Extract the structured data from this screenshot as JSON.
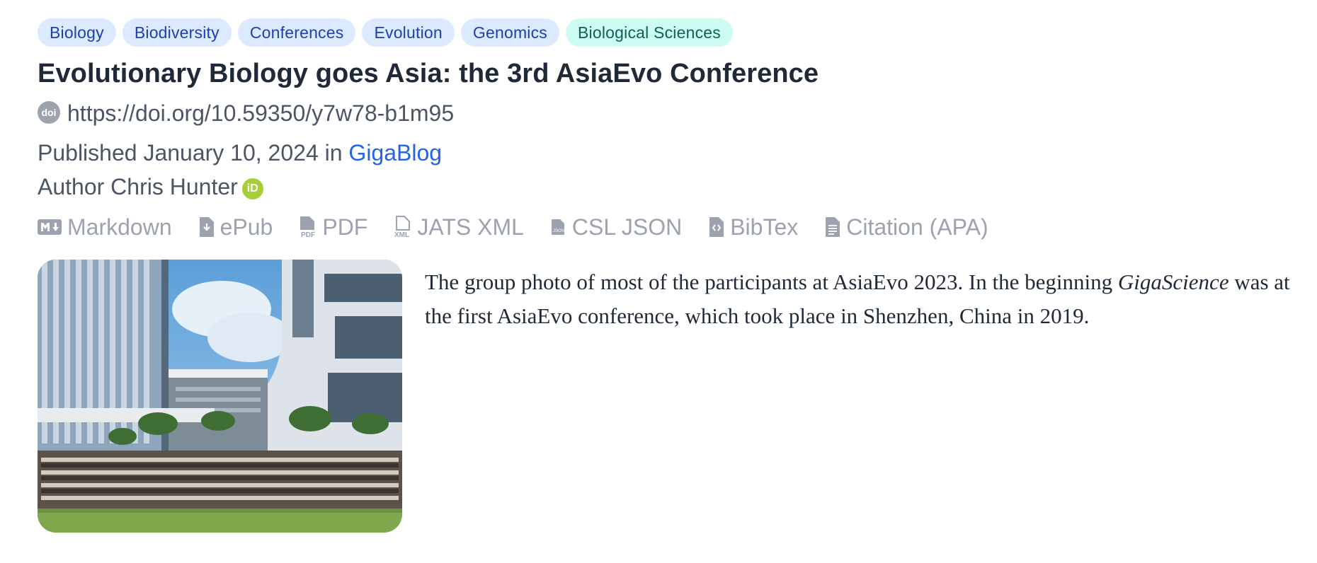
{
  "tags": [
    {
      "label": "Biology"
    },
    {
      "label": "Biodiversity"
    },
    {
      "label": "Conferences"
    },
    {
      "label": "Evolution"
    },
    {
      "label": "Genomics"
    },
    {
      "label": "Biological Sciences"
    }
  ],
  "title": "Evolutionary Biology goes Asia: the 3rd AsiaEvo Conference",
  "doi": {
    "icon": "doi-icon",
    "icon_text": "doi",
    "url": "https://doi.org/10.59350/y7w78-b1m95"
  },
  "published": {
    "prefix": "Published",
    "date": "January 10, 2024",
    "in": "in",
    "blog": "GigaBlog"
  },
  "author": {
    "prefix": "Author",
    "name": "Chris Hunter",
    "orcid_icon": "orcid-icon",
    "orcid_text": "iD"
  },
  "formats": [
    {
      "label": "Markdown",
      "icon": "markdown-icon"
    },
    {
      "label": "ePub",
      "icon": "epub-icon"
    },
    {
      "label": "PDF",
      "icon": "pdf-icon"
    },
    {
      "label": "JATS XML",
      "icon": "xml-icon"
    },
    {
      "label": "CSL JSON",
      "icon": "json-icon"
    },
    {
      "label": "BibTex",
      "icon": "bibtex-icon"
    },
    {
      "label": "Citation (APA)",
      "icon": "citation-icon"
    }
  ],
  "caption": {
    "part1": "The group photo of most of the participants at AsiaEvo 2023. In the beginning",
    "italic": "GigaScience",
    "part2": "was at the first AsiaEvo conference, which took place in Shenzhen, China in 2019."
  },
  "colors": {
    "tag_bg": "#dbeafe",
    "tag_text": "#1e40af",
    "tag_teal_bg": "#ccfbf1",
    "tag_teal_text": "#115e59",
    "link": "#2563eb",
    "muted": "#9ca3af",
    "orcid": "#a6ce39"
  }
}
